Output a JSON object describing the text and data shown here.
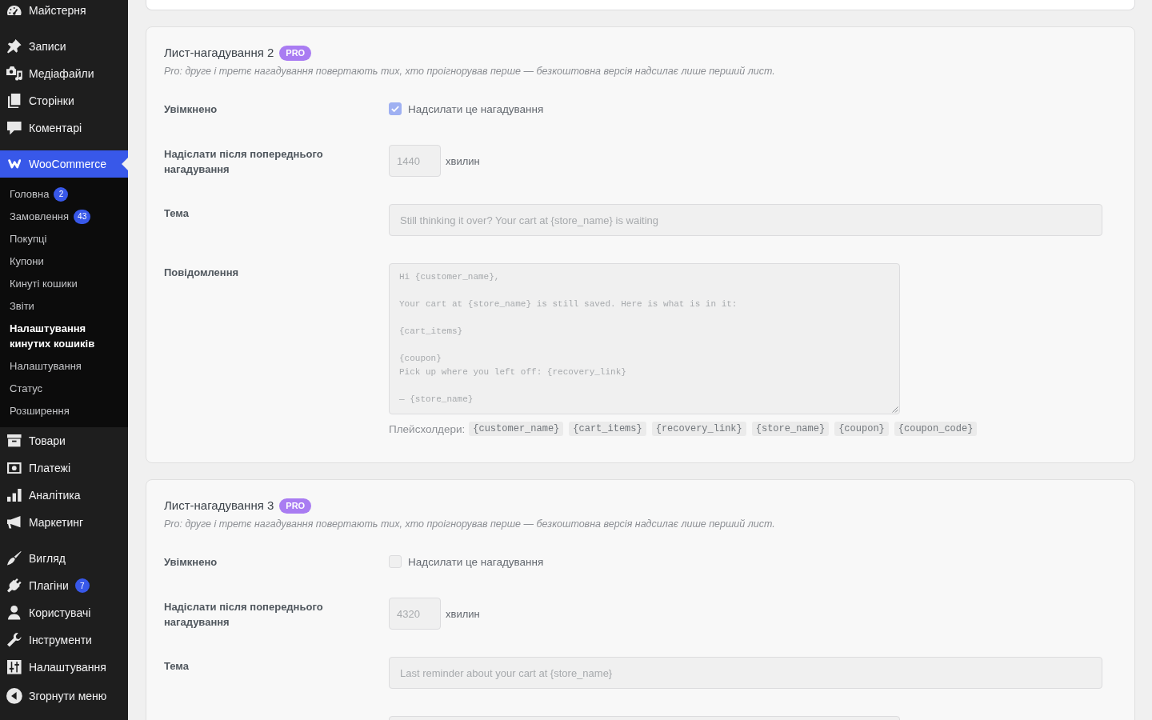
{
  "sidebar": {
    "sections": [
      {
        "items": [
          {
            "label": "Майстерня",
            "selected": false
          }
        ]
      },
      {
        "items": [
          {
            "label": "Записи",
            "selected": false
          },
          {
            "label": "Медіафайли",
            "selected": false
          },
          {
            "label": "Сторінки",
            "selected": false
          },
          {
            "label": "Коментарі",
            "selected": false
          }
        ]
      },
      {
        "items": [
          {
            "label": "WooCommerce",
            "selected": true,
            "children": [
              {
                "label": "Головна",
                "badge": "2",
                "selected": false
              },
              {
                "label": "Замовлення",
                "badge": "43",
                "selected": false
              },
              {
                "label": "Покупці",
                "selected": false
              },
              {
                "label": "Купони",
                "selected": false
              },
              {
                "label": "Кинуті кошики",
                "selected": false
              },
              {
                "label": "Звіти",
                "selected": false
              },
              {
                "label": "Налаштування кинутих кошиків",
                "selected": true
              },
              {
                "label": "Налаштування",
                "selected": false
              },
              {
                "label": "Статус",
                "selected": false
              },
              {
                "label": "Розширення",
                "selected": false
              }
            ]
          },
          {
            "label": "Товари",
            "selected": false
          },
          {
            "label": "Платежі",
            "selected": false
          },
          {
            "label": "Аналітика",
            "selected": false
          },
          {
            "label": "Маркетинг",
            "selected": false
          }
        ]
      },
      {
        "items": [
          {
            "label": "Вигляд",
            "selected": false
          },
          {
            "label": "Плагіни",
            "badge": "7",
            "selected": false
          },
          {
            "label": "Користувачі",
            "selected": false
          },
          {
            "label": "Інструменти",
            "selected": false
          },
          {
            "label": "Налаштування",
            "selected": false
          }
        ]
      }
    ],
    "collapse_button": "Згорнути меню"
  },
  "reminders": [
    {
      "title": "Лист-нагадування 2",
      "badge": "PRO",
      "note": "Pro: друге і третє нагадування повертають тих, хто проігнорував перше — безкоштовна версія надсилає лише перший лист.",
      "disabled": true,
      "fields": [
        {
          "kind": "checkbox",
          "label": "Увімкнено",
          "text": "Надсилати це нагадування",
          "checked": true
        },
        {
          "kind": "number",
          "label": "Надіслати після попереднього нагадування",
          "value": "1440",
          "unit": "хвилин"
        },
        {
          "kind": "text",
          "label": "Тема",
          "value": "Still thinking it over? Your cart at {store_name} is waiting"
        },
        {
          "kind": "textarea",
          "label": "Повідомлення",
          "value": "Hi {customer_name},\n\nYour cart at {store_name} is still saved. Here is what is in it:\n\n{cart_items}\n\n{coupon}\nPick up where you left off: {recovery_link}\n\n— {store_name}"
        }
      ],
      "placeholders_label": "Плейсхолдери:",
      "placeholders": [
        "{customer_name}",
        "{cart_items}",
        "{recovery_link}",
        "{store_name}",
        "{coupon}",
        "{coupon_code}"
      ]
    },
    {
      "title": "Лист-нагадування 3",
      "badge": "PRO",
      "note": "Pro: друге і третє нагадування повертають тих, хто проігнорував перше — безкоштовна версія надсилає лише перший лист.",
      "disabled": true,
      "fields": [
        {
          "kind": "checkbox",
          "label": "Увімкнено",
          "text": "Надсилати це нагадування",
          "checked": false
        },
        {
          "kind": "number",
          "label": "Надіслати після попереднього нагадування",
          "value": "4320",
          "unit": "хвилин"
        },
        {
          "kind": "text",
          "label": "Тема",
          "value": "Last reminder about your cart at {store_name}"
        },
        {
          "kind": "textarea"
        }
      ]
    }
  ]
}
